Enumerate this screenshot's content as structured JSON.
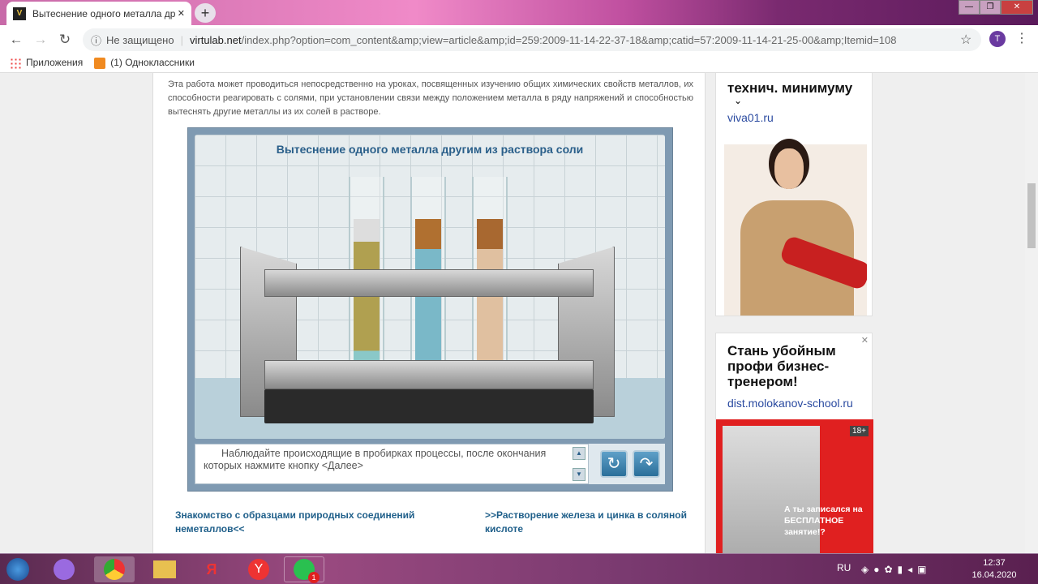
{
  "browser": {
    "tab_title": "Вытеснение одного металла др",
    "tab_close": "✕",
    "new_tab": "+",
    "security": "Не защищено",
    "url_host": "virtulab.net",
    "url_path": "/index.php?option=com_content&amp;view=article&amp;id=259:2009-11-14-22-37-18&amp;catid=57:2009-11-14-21-25-00&amp;Itemid=108",
    "profile": "T",
    "window_buttons": [
      "—",
      "❐",
      "✕"
    ]
  },
  "bookmarks": [
    {
      "label": "Приложения",
      "icon": "apps-grid-icon"
    },
    {
      "label": "(1) Одноклассники",
      "icon": "ok-icon"
    }
  ],
  "article": {
    "intro": "Эта работа может проводиться непосредственно на уроках, посвященных изучению общих химических свойств металлов, их способности реагировать с солями, при установлении связи между положением металла в ряду напряжений и способностью вытеснять другие металлы из их солей в растворе."
  },
  "simulation": {
    "title": "Вытеснение одного металла другим из раствора соли",
    "instruction": "Наблюдайте происходящие в пробирках процессы, после окончания которых нажмите кнопку <Далее>",
    "buttons": {
      "restart": "↻",
      "next": "↷"
    },
    "scroll_up": "▲",
    "scroll_down": "▼"
  },
  "links": {
    "prev": "Знакомство с образцами природных соединений неметаллов<<",
    "next": ">>Растворение железа и цинка в соляной кислоте"
  },
  "ads": [
    {
      "headline": "технич. минимуму",
      "domain": "viva01.ru"
    },
    {
      "headline": "Стань убойным профи бизнес-тренером!",
      "domain": "dist.molokanov-school.ru",
      "age": "18+",
      "banner_text": "А ты записался на БЕСПЛАТНОЕ занятие!?",
      "close": "✕"
    }
  ],
  "taskbar": {
    "lang": "RU",
    "time": "12:37",
    "date": "16.04.2020",
    "badge": "1"
  }
}
